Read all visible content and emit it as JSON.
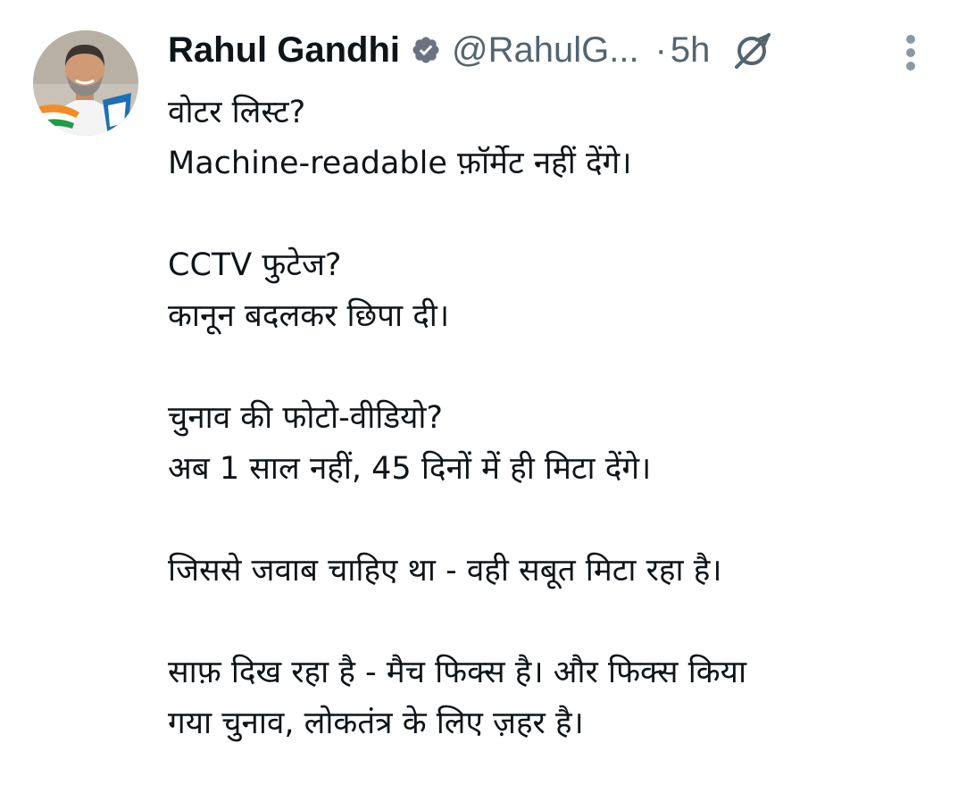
{
  "tweet": {
    "author_name": "Rahul Gandhi",
    "handle": "@RahulG...",
    "separator": "·",
    "time": "5h",
    "paragraphs": [
      [
        "वोटर लिस्ट?",
        "Machine-readable फ़ॉर्मेट नहीं देंगे।"
      ],
      [
        "CCTV फुटेज?",
        "कानून बदलकर छिपा दी।"
      ],
      [
        "चुनाव की फोटो-वीडियो?",
        "अब 1 साल नहीं, 45 दिनों में ही मिटा देंगे।"
      ],
      [
        "जिससे जवाब चाहिए था - वही सबूत मिटा रहा है।"
      ],
      [
        "साफ़ दिख रहा है - मैच फिक्स है। और फिक्स किया",
        "गया चुनाव, लोकतंत्र के लिए ज़हर है।"
      ]
    ]
  },
  "icons": {
    "verified": "verified-badge-icon",
    "grok": "grok-slash-circle-icon",
    "more": "more-vertical-icon"
  },
  "colors": {
    "text": "#0f1419",
    "secondary": "#536471",
    "badge": "#6b7280",
    "background": "#ffffff"
  }
}
